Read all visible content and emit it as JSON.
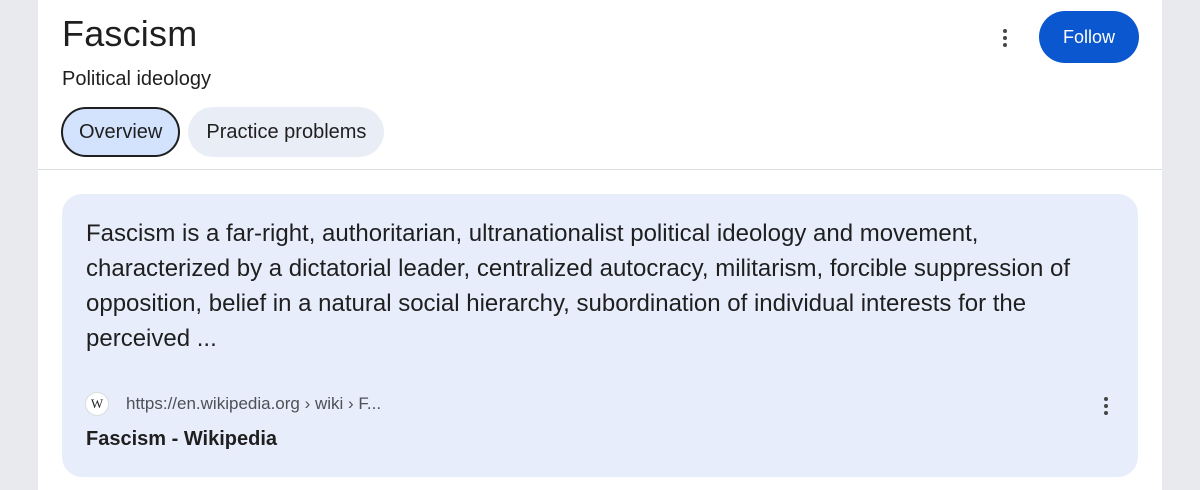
{
  "header": {
    "title": "Fascism",
    "subtitle": "Political ideology",
    "more_icon": "more-vertical-icon",
    "follow_label": "Follow"
  },
  "tabs": [
    {
      "label": "Overview",
      "active": true
    },
    {
      "label": "Practice problems",
      "active": false
    }
  ],
  "result": {
    "snippet": "Fascism is a far-right, authoritarian, ultranationalist political ideology and movement, characterized by a dictatorial leader, centralized autocracy, militarism, forcible suppression of opposition, belief in a natural social hierarchy, subordination of individual interests for the perceived ...",
    "favicon_glyph": "W",
    "url": "https://en.wikipedia.org › wiki › F...",
    "title": "Fascism - Wikipedia",
    "more_icon": "more-vertical-icon"
  },
  "colors": {
    "accent": "#0b57d0",
    "card_bg": "#e8edfb",
    "active_tab_bg": "#d3e3fd",
    "page_bg": "#e8eaed"
  }
}
